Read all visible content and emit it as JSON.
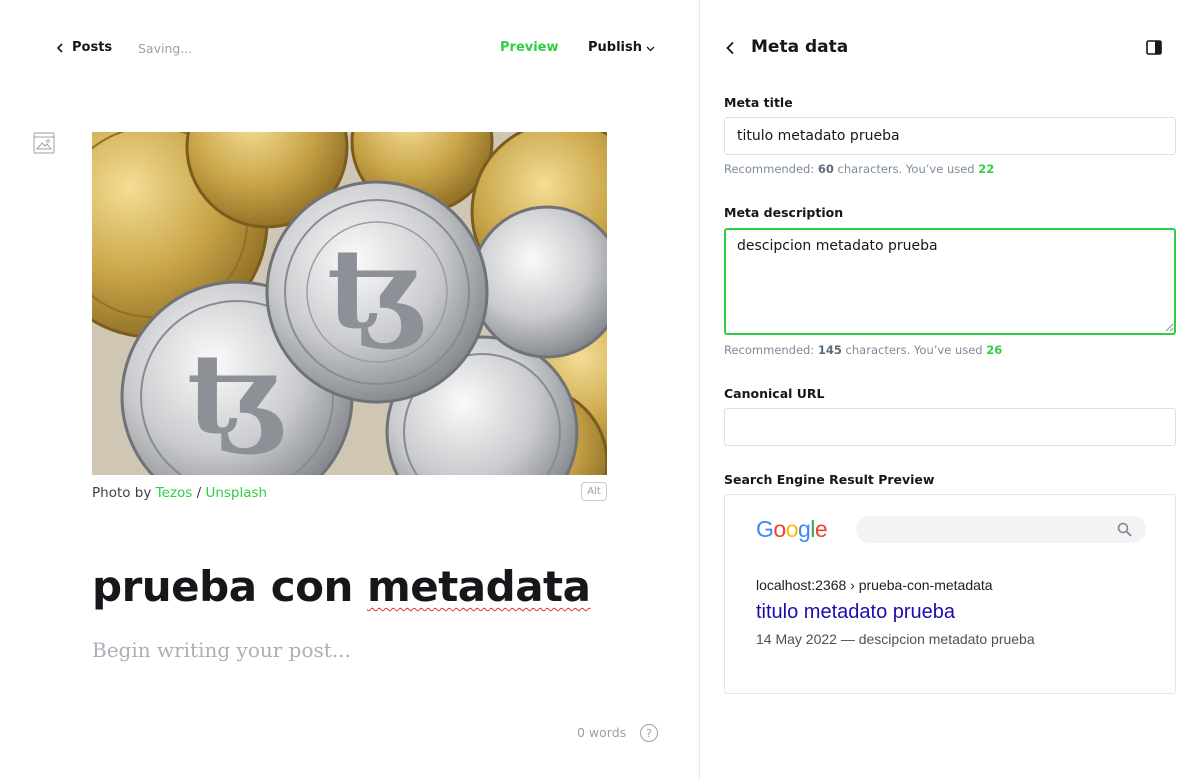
{
  "editor": {
    "back_label": "Posts",
    "status": "Saving...",
    "preview_label": "Preview",
    "publish_label": "Publish",
    "caption": {
      "prefix": "Photo by ",
      "author": "Tezos",
      "separator": " / ",
      "source": "Unsplash"
    },
    "alt_label": "Alt",
    "title_part1": "prueba con ",
    "title_part2": "metadata",
    "body_placeholder": "Begin writing your post...",
    "word_count": "0 words",
    "help_label": "?"
  },
  "panel": {
    "title": "Meta data",
    "meta_title": {
      "label": "Meta title",
      "value": "titulo metadato prueba",
      "hint_prefix": "Recommended: ",
      "hint_recommended": "60",
      "hint_middle": " characters. You’ve used ",
      "hint_used": "22"
    },
    "meta_description": {
      "label": "Meta description",
      "value": "descipcion metadato prueba",
      "hint_prefix": "Recommended: ",
      "hint_recommended": "145",
      "hint_middle": " characters. You’ve used ",
      "hint_used": "26"
    },
    "canonical_url": {
      "label": "Canonical URL",
      "value": ""
    },
    "serp": {
      "label": "Search Engine Result Preview",
      "logo_letters": [
        "G",
        "o",
        "o",
        "g",
        "l",
        "e"
      ],
      "url": "localhost:2368 › prueba-con-metadata",
      "title": "titulo metadato prueba",
      "description": "14 May 2022 — descipcion metadato prueba"
    }
  },
  "colors": {
    "accent": "#30cf43",
    "link": "#1a0dab",
    "google_blue": "#4285f4",
    "google_red": "#ea4335",
    "google_yellow": "#fbbc05",
    "google_green": "#34a853"
  }
}
